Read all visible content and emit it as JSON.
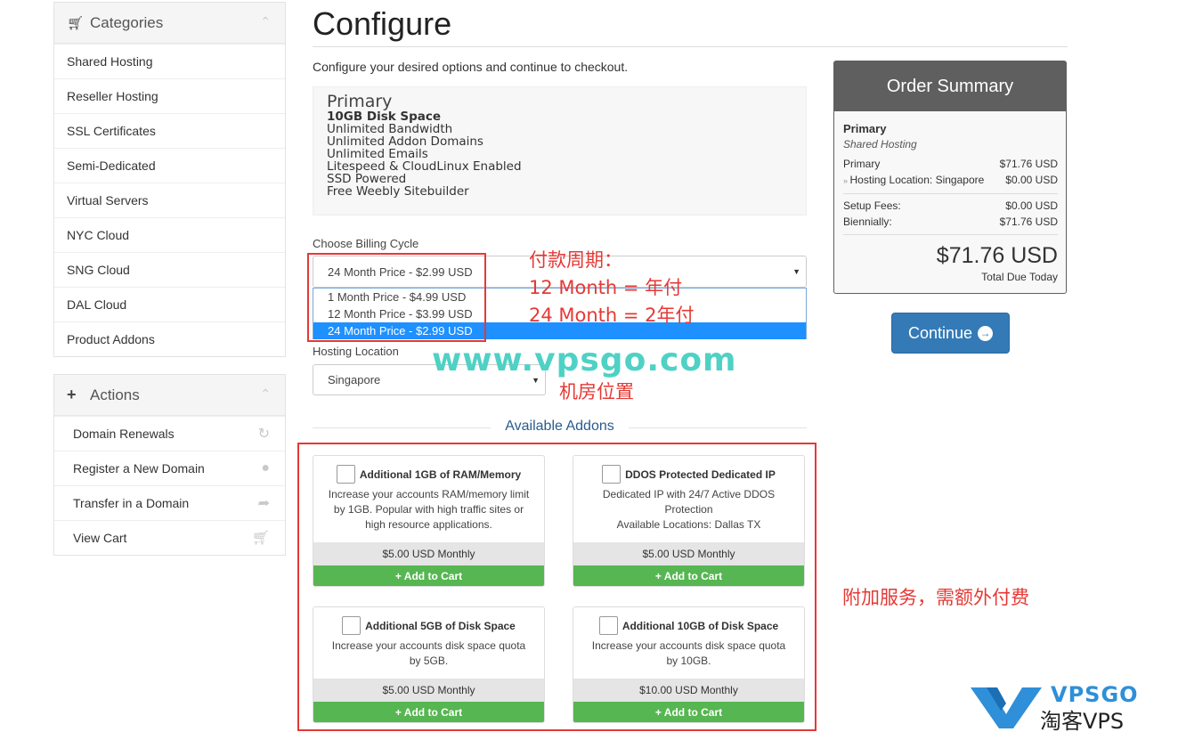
{
  "sidebar": {
    "categories": {
      "title": "Categories",
      "items": [
        "Shared Hosting",
        "Reseller Hosting",
        "SSL Certificates",
        "Semi-Dedicated",
        "Virtual Servers",
        "NYC Cloud",
        "SNG Cloud",
        "DAL Cloud",
        "Product Addons"
      ]
    },
    "actions": {
      "title": "Actions",
      "items": [
        "Domain Renewals",
        "Register a New Domain",
        "Transfer in a Domain",
        "View Cart"
      ]
    }
  },
  "page": {
    "title": "Configure",
    "subtitle": "Configure your desired options and continue to checkout."
  },
  "product": {
    "name": "Primary",
    "features": [
      "10GB Disk Space",
      "Unlimited Bandwidth",
      "Unlimited Addon Domains",
      "Unlimited Emails",
      "Litespeed & CloudLinux Enabled",
      "SSD Powered",
      "Free Weebly Sitebuilder"
    ]
  },
  "billing": {
    "label": "Choose Billing Cycle",
    "selected": "24 Month Price - $2.99 USD",
    "options": [
      "1 Month Price - $4.99 USD",
      "12 Month Price - $3.99 USD",
      "24 Month Price - $2.99 USD"
    ]
  },
  "location": {
    "label": "Hosting Location",
    "selected": "Singapore"
  },
  "annotations": {
    "billing_line1": "付款周期：",
    "billing_line2": "12 Month = 年付",
    "billing_line3": "24 Month = 2年付",
    "location": "机房位置",
    "addons": "附加服务，需额外付费",
    "watermark": "www.vpsgo.com",
    "logo_text": "VPSGO",
    "logo_cn": "淘客VPS"
  },
  "addons": {
    "heading": "Available Addons",
    "items": [
      {
        "name": "Additional 1GB of RAM/Memory",
        "desc": [
          "Increase your accounts RAM/memory limit",
          "by 1GB. Popular with high traffic sites or",
          "high resource applications."
        ],
        "price": "$5.00 USD Monthly",
        "button": "Add to Cart"
      },
      {
        "name": "DDOS Protected Dedicated IP",
        "desc": [
          "Dedicated IP with 24/7 Active DDOS",
          "Protection",
          "Available Locations: Dallas TX"
        ],
        "price": "$5.00 USD Monthly",
        "button": "Add to Cart"
      },
      {
        "name": "Additional 5GB of Disk Space",
        "desc": [
          "Increase your accounts disk space quota",
          "by 5GB."
        ],
        "price": "$5.00 USD Monthly",
        "button": "Add to Cart"
      },
      {
        "name": "Additional 10GB of Disk Space",
        "desc": [
          "Increase your accounts disk space quota",
          "by 10GB."
        ],
        "price": "$10.00 USD Monthly",
        "button": "Add to Cart"
      }
    ]
  },
  "summary": {
    "title": "Order Summary",
    "product": "Primary",
    "group": "Shared Hosting",
    "line_name": "Primary",
    "line_price": "$71.76 USD",
    "option_name": "Hosting Location: Singapore",
    "option_price": "$0.00 USD",
    "setup_label": "Setup Fees:",
    "setup_value": "$0.00 USD",
    "cycle_label": "Biennially:",
    "cycle_value": "$71.76 USD",
    "total": "$71.76 USD",
    "total_label": "Total Due Today"
  },
  "continue_label": "Continue",
  "colors": {
    "accent": "#347ab7",
    "add_button": "#56b651",
    "summary_header": "#5f5f5f",
    "annotation": "#e53935",
    "watermark": "#4fd1c5"
  }
}
